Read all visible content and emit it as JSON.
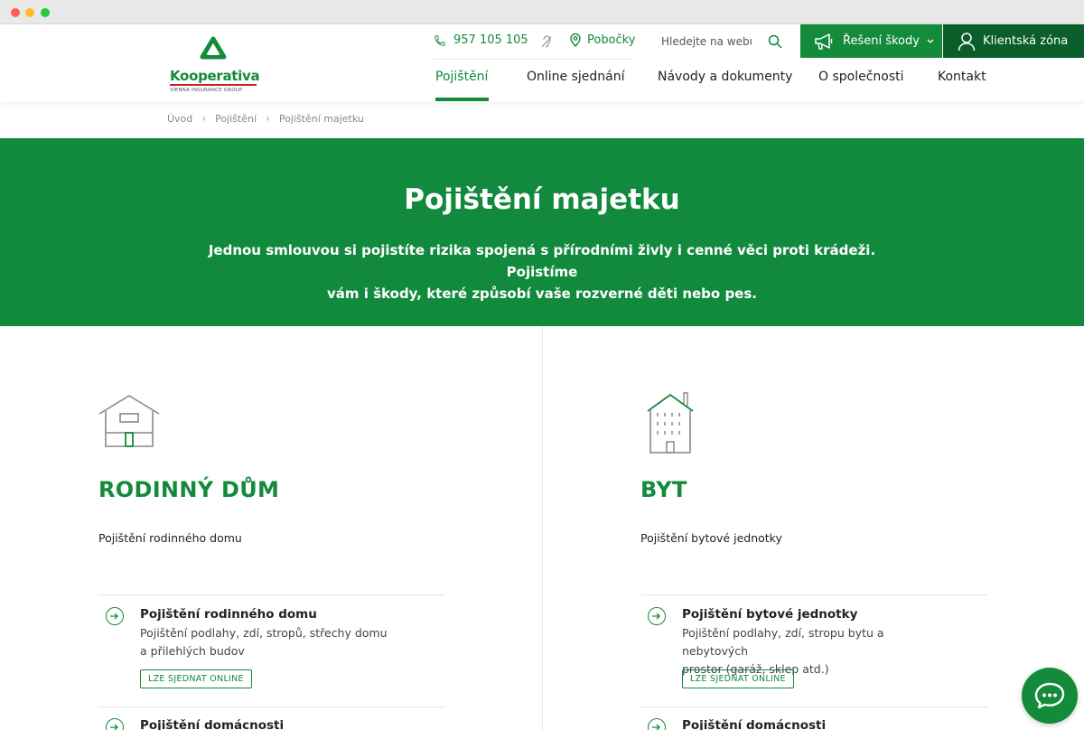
{
  "brand": {
    "name": "Kooperativa",
    "tagline": "VIENNA INSURANCE GROUP"
  },
  "utility": {
    "phone": "957 105 105",
    "branches": "Pobočky",
    "search_placeholder": "Hledejte na webu",
    "damage_button": "Řešení škody",
    "client_button": "Klientská zóna"
  },
  "nav": {
    "items": [
      "Pojištění",
      "Online sjednání",
      "Návody a dokumenty",
      "O společnosti",
      "Kontakt"
    ],
    "active": "Pojištění"
  },
  "breadcrumb": [
    "Úvod",
    "Pojištění",
    "Pojištění majetku"
  ],
  "hero": {
    "title": "Pojištění majetku",
    "text_line1": "Jednou smlouvou si pojistíte rizika spojená s přírodními živly i cenné věci proti krádeži. Pojistíme",
    "text_line2": "vám i škody, které způsobí vaše rozverné děti nebo pes."
  },
  "columns": [
    {
      "title": "RODINNÝ DŮM",
      "subtitle": "Pojištění rodinného domu",
      "items": [
        {
          "title": "Pojištění rodinného domu",
          "desc_line1": "Pojištění podlahy, zdí, stropů, střechy domu",
          "desc_line2": "a přilehlých budov",
          "badge": "LZE SJEDNAT ONLINE"
        },
        {
          "title": "Pojištění domácnosti"
        }
      ]
    },
    {
      "title": "BYT",
      "subtitle": "Pojištění bytové jednotky",
      "items": [
        {
          "title": "Pojištění bytové jednotky",
          "desc_line1": "Pojištění podlahy, zdí, stropu bytu a nebytových",
          "desc_line2": "prostor (garáž, sklep atd.)",
          "badge": "LZE SJEDNAT ONLINE"
        },
        {
          "title": "Pojištění domácnosti"
        }
      ]
    }
  ],
  "colors": {
    "brand_green": "#148a3b",
    "dark_green": "#0b5e2a",
    "hero_green": "#128a3e",
    "accent_red": "#c62828"
  },
  "icons": [
    "phone-icon",
    "ear-icon",
    "location-pin-icon",
    "search-icon",
    "megaphone-icon",
    "chevron-down-icon",
    "user-icon",
    "chevron-right-icon",
    "house-icon",
    "apartment-building-icon",
    "arrow-right-circle-icon",
    "chat-bubble-icon"
  ]
}
